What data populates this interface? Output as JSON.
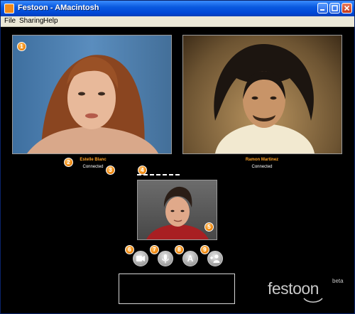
{
  "window": {
    "title": "Festoon - AMacintosh"
  },
  "menu": [
    "File",
    "Sharing",
    "Help"
  ],
  "peers": [
    {
      "name": "Estelle Blanc",
      "status": "Connected"
    },
    {
      "name": "Ramon Martinez",
      "status": "Connected"
    }
  ],
  "callouts": [
    "1",
    "2",
    "3",
    "4",
    "5",
    "6",
    "7",
    "8",
    "9"
  ],
  "controls": {
    "text_label": "A"
  },
  "logo": {
    "name": "festoon",
    "badge": "beta"
  },
  "colors": {
    "accent": "#f08a10",
    "peer_name": "#ffa227",
    "background": "#000000"
  },
  "icons": [
    "camera-icon",
    "microphone-icon",
    "text-icon",
    "add-user-icon"
  ]
}
